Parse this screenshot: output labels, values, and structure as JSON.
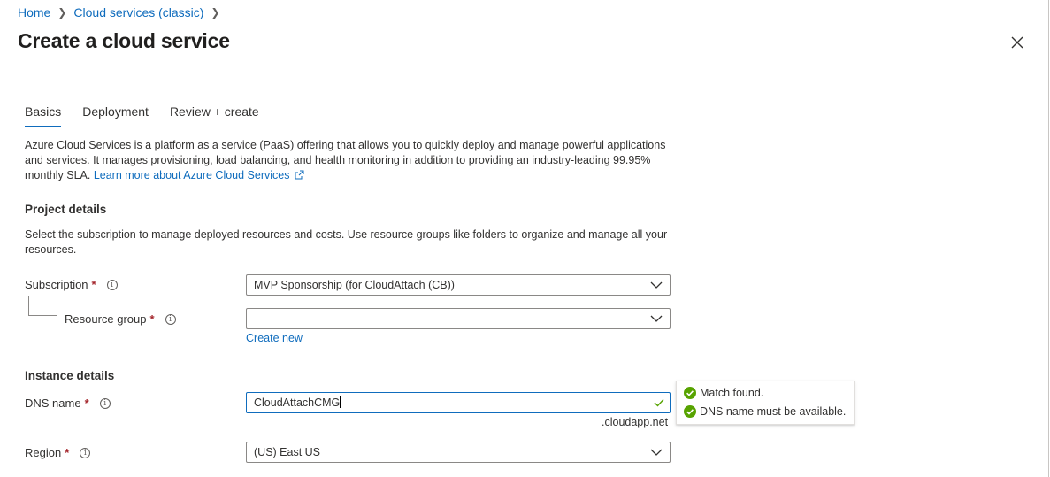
{
  "breadcrumb": {
    "home": "Home",
    "parent": "Cloud services (classic)"
  },
  "page_title": "Create a cloud service",
  "tabs": [
    {
      "label": "Basics",
      "active": true
    },
    {
      "label": "Deployment",
      "active": false
    },
    {
      "label": "Review + create",
      "active": false
    }
  ],
  "intro": {
    "text": "Azure Cloud Services is a platform as a service (PaaS) offering that allows you to quickly deploy and manage powerful applications and services. It manages provisioning, load balancing, and health monitoring in addition to providing an industry-leading 99.95% monthly SLA.",
    "learn_more": "Learn more about Azure Cloud Services"
  },
  "project": {
    "heading": "Project details",
    "description": "Select the subscription to manage deployed resources and costs. Use resource groups like folders to organize and manage all your resources.",
    "subscription_label": "Subscription",
    "subscription_value": "MVP Sponsorship (for CloudAttach (CB))",
    "resource_group_label": "Resource group",
    "resource_group_value": "",
    "create_new": "Create new"
  },
  "instance": {
    "heading": "Instance details",
    "dns_label": "DNS name",
    "dns_value": "CloudAttachCMG",
    "dns_suffix": ".cloudapp.net",
    "region_label": "Region",
    "region_value": "(US) East US"
  },
  "validation": {
    "messages": [
      "Match found.",
      "DNS name must be available."
    ]
  },
  "colors": {
    "accent": "#0f6cbd",
    "required": "#a4262c",
    "success": "#57a300"
  }
}
